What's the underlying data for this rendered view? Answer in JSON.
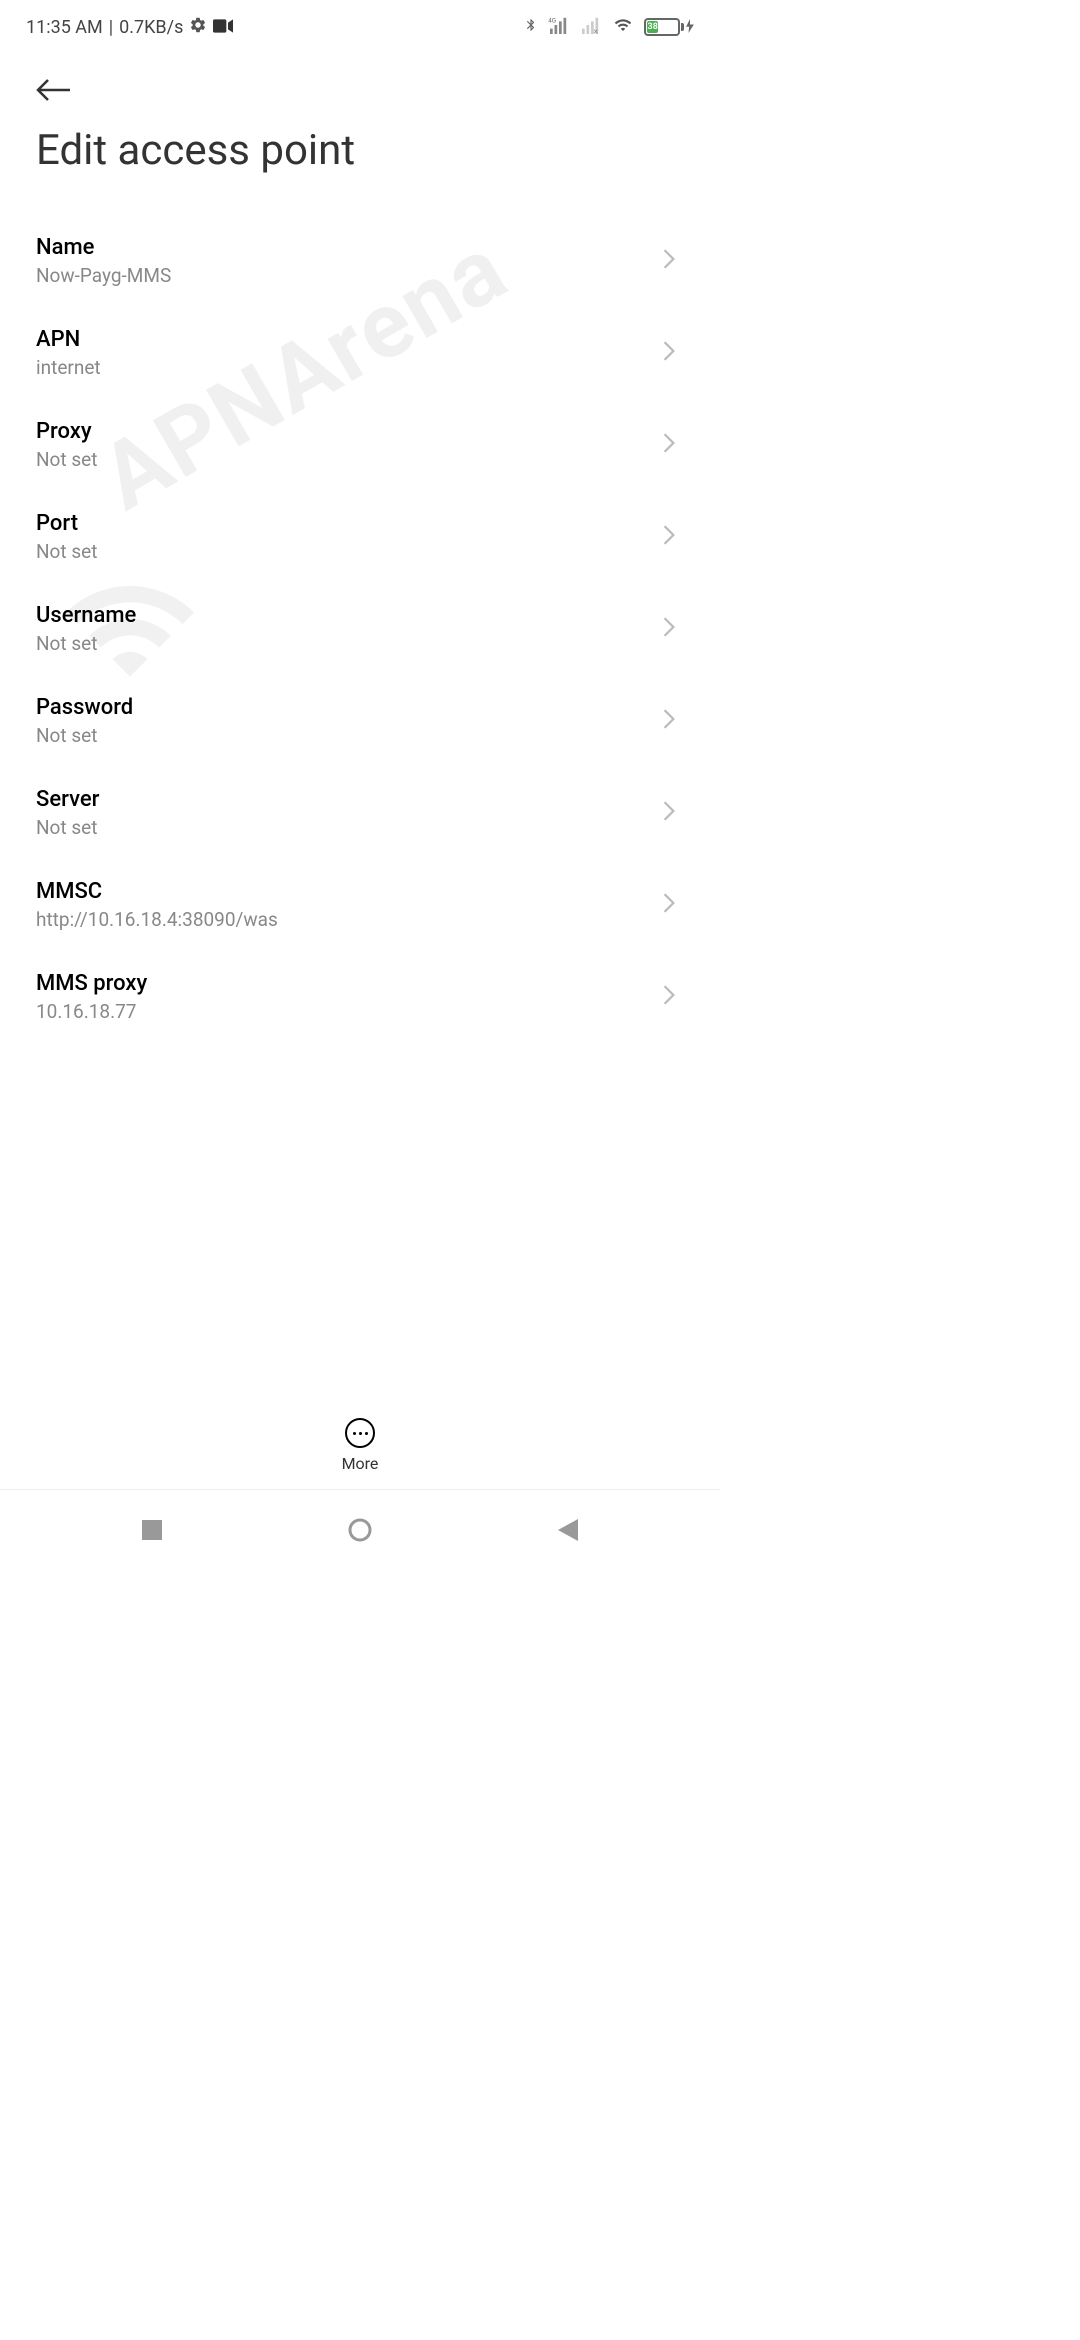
{
  "status_bar": {
    "time": "11:35 AM",
    "separator": "|",
    "data_rate": "0.7KB/s",
    "battery_percent": "38"
  },
  "page": {
    "title": "Edit access point"
  },
  "watermark": "APNArena",
  "settings": [
    {
      "label": "Name",
      "value": "Now-Payg-MMS"
    },
    {
      "label": "APN",
      "value": "internet"
    },
    {
      "label": "Proxy",
      "value": "Not set"
    },
    {
      "label": "Port",
      "value": "Not set"
    },
    {
      "label": "Username",
      "value": "Not set"
    },
    {
      "label": "Password",
      "value": "Not set"
    },
    {
      "label": "Server",
      "value": "Not set"
    },
    {
      "label": "MMSC",
      "value": "http://10.16.18.4:38090/was"
    },
    {
      "label": "MMS proxy",
      "value": "10.16.18.77"
    }
  ],
  "bottom": {
    "more_label": "More"
  }
}
